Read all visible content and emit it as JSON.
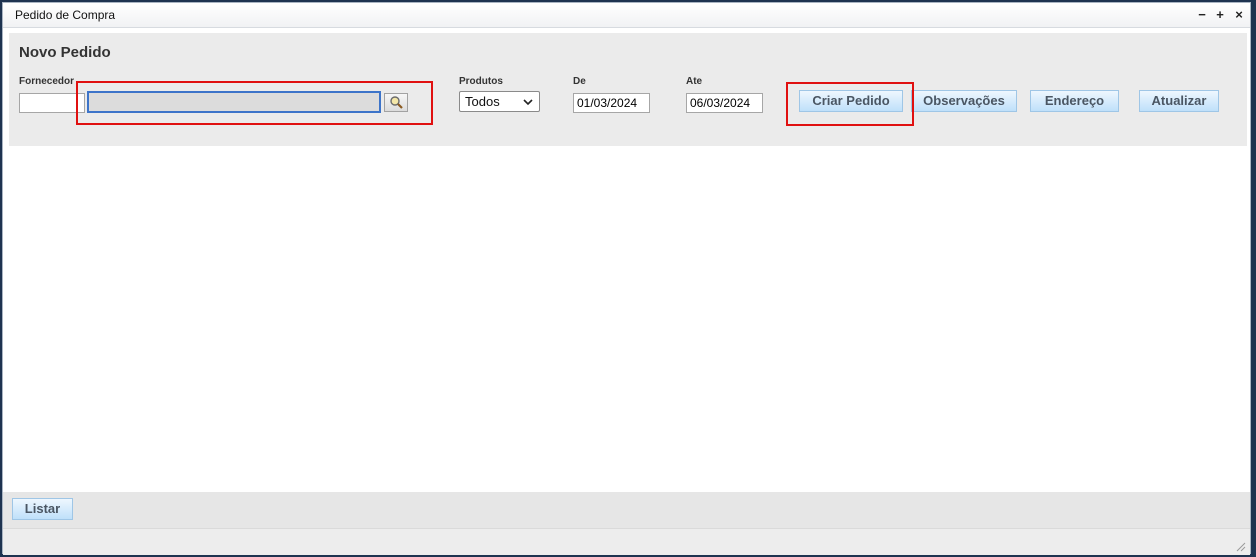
{
  "window": {
    "title": "Pedido de Compra",
    "controls": {
      "minimize": "−",
      "maximize": "+",
      "close": "×"
    }
  },
  "form": {
    "heading": "Novo Pedido",
    "fornecedor": {
      "label": "Fornecedor",
      "code_value": "",
      "name_value": ""
    },
    "produtos": {
      "label": "Produtos",
      "selected": "Todos"
    },
    "de": {
      "label": "De",
      "value": "01/03/2024"
    },
    "ate": {
      "label": "Ate",
      "value": "06/03/2024"
    },
    "buttons": {
      "criar_pedido": "Criar Pedido",
      "observacoes": "Observações",
      "endereco": "Endereço",
      "atualizar": "Atualizar"
    }
  },
  "footer": {
    "listar": "Listar"
  },
  "icons": {
    "search": "magnifier-icon",
    "dropdown": "chevron-down-icon",
    "resize": "resize-grip-icon"
  },
  "colors": {
    "highlight": "#e01010",
    "button_gradient_top": "#eef7fe",
    "button_gradient_bottom": "#bfe0fa",
    "focus_border": "#3d74c9"
  }
}
